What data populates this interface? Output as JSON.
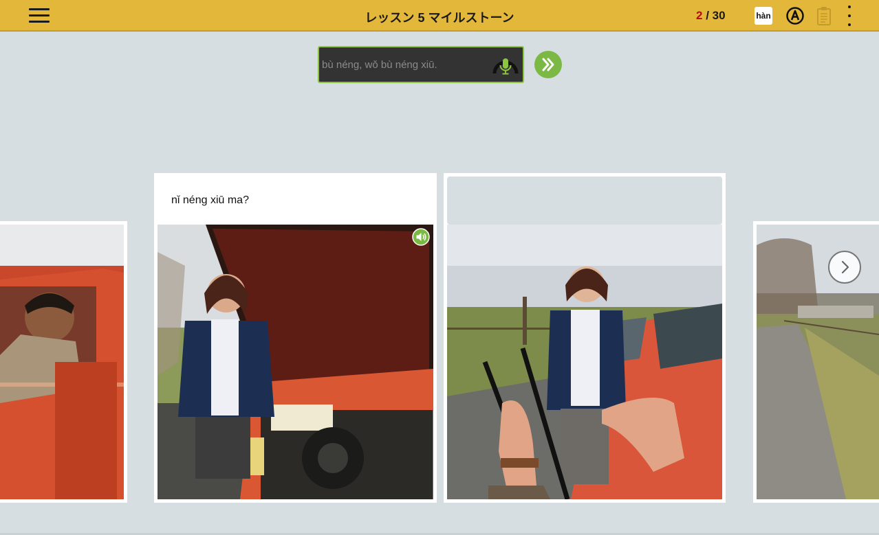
{
  "header": {
    "title": "レッスン 5 マイルストーン",
    "progress_current": "2",
    "progress_total": "/ 30",
    "han_label": "hàn",
    "menu_icon": "hamburger-menu-icon",
    "a_icon": "circled-a-icon",
    "clipboard_icon": "clipboard-icon",
    "more_icon": "kebab-menu-icon"
  },
  "answer": {
    "placeholder": "bù néng, wǒ bù néng xiū.",
    "mic_icon": "microphone-icon",
    "next_icon": "double-chevron-right-icon"
  },
  "cards": {
    "active_caption": "nǐ néng xiū ma?",
    "sound_icon": "speaker-icon",
    "next_arrow_icon": "chevron-right-icon"
  },
  "colors": {
    "header": "#e3b73a",
    "accent_green": "#7bb844",
    "progress_current": "#b50d0d",
    "background": "#d6dee2"
  }
}
